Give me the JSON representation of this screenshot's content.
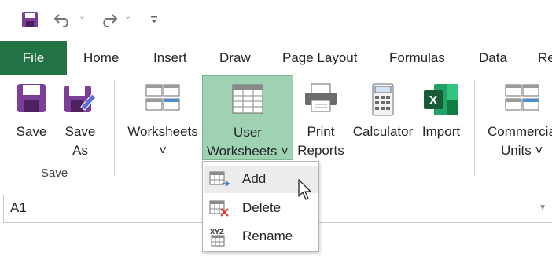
{
  "qat": {
    "save_icon": "save-icon",
    "undo_icon": "undo-icon",
    "redo_icon": "redo-icon",
    "customize_icon": "customize-qat-icon"
  },
  "tabs": [
    {
      "label": "File"
    },
    {
      "label": "Home"
    },
    {
      "label": "Insert"
    },
    {
      "label": "Draw"
    },
    {
      "label": "Page Layout"
    },
    {
      "label": "Formulas"
    },
    {
      "label": "Data"
    },
    {
      "label": "Re"
    }
  ],
  "ribbon": {
    "save": {
      "label": "Save"
    },
    "save_as": {
      "line1": "Save",
      "line2": "As"
    },
    "group_save": "Save",
    "worksheets": {
      "line1": "Worksheets",
      "caret": "˅"
    },
    "user_worksheets": {
      "line1": "User",
      "line2": "Worksheets",
      "caret": "˅"
    },
    "print_reports": {
      "line1": "Print",
      "line2": "Reports"
    },
    "calculator": {
      "label": "Calculator"
    },
    "import": {
      "label": "Import"
    },
    "commercial_units": {
      "line1": "Commercial",
      "line2": "Units",
      "caret": "˅"
    }
  },
  "namebox": {
    "value": "A1"
  },
  "menu": {
    "items": [
      {
        "label": "Add"
      },
      {
        "label": "Delete"
      },
      {
        "label": "Rename"
      }
    ]
  },
  "colors": {
    "file_tab": "#217346",
    "active_button": "#9fd1b3",
    "save_icon": "#7b3f98",
    "excel_green": "#1e7145"
  }
}
